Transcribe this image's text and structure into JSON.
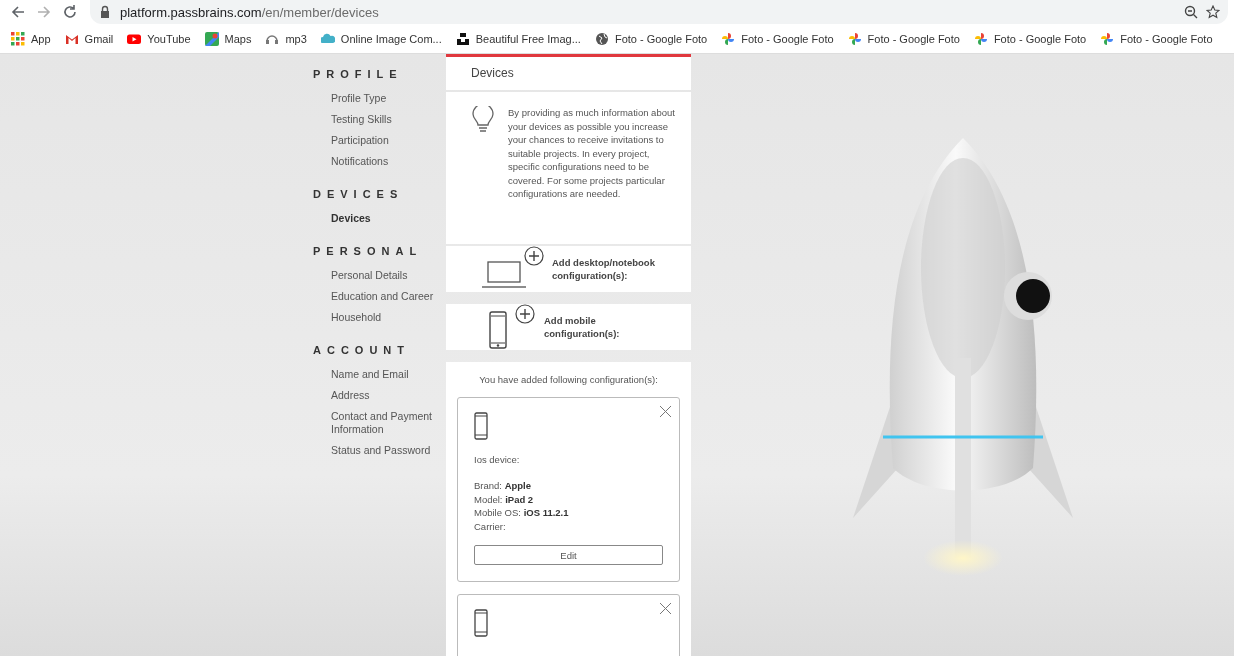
{
  "browser": {
    "url_host": "platform.passbrains.com",
    "url_path": "/en/member/devices",
    "bookmarks": [
      {
        "kind": "apps",
        "label": "App"
      },
      {
        "kind": "gmail",
        "label": "Gmail"
      },
      {
        "kind": "youtube",
        "label": "YouTube"
      },
      {
        "kind": "maps",
        "label": "Maps"
      },
      {
        "kind": "mp3",
        "label": "mp3"
      },
      {
        "kind": "cloud",
        "label": "Online Image Com..."
      },
      {
        "kind": "block",
        "label": "Beautiful Free Imag..."
      },
      {
        "kind": "globe",
        "label": "Foto - Google Foto"
      },
      {
        "kind": "pinwheel",
        "label": "Foto - Google Foto"
      },
      {
        "kind": "pinwheel",
        "label": "Foto - Google Foto"
      },
      {
        "kind": "pinwheel",
        "label": "Foto - Google Foto"
      },
      {
        "kind": "pinwheel",
        "label": "Foto - Google Foto"
      }
    ]
  },
  "sidebar": {
    "sections": [
      {
        "title": "PROFILE",
        "items": [
          {
            "label": "Profile Type",
            "selected": false
          },
          {
            "label": "Testing Skills",
            "selected": false
          },
          {
            "label": "Participation",
            "selected": false
          },
          {
            "label": "Notifications",
            "selected": false
          }
        ]
      },
      {
        "title": "DEVICES",
        "items": [
          {
            "label": "Devices",
            "selected": true
          }
        ]
      },
      {
        "title": "PERSONAL",
        "items": [
          {
            "label": "Personal Details",
            "selected": false
          },
          {
            "label": "Education and Career",
            "selected": false
          },
          {
            "label": "Household",
            "selected": false
          }
        ]
      },
      {
        "title": "ACCOUNT",
        "items": [
          {
            "label": "Name and Email",
            "selected": false
          },
          {
            "label": "Address",
            "selected": false
          },
          {
            "label": "Contact and Payment Information",
            "selected": false
          },
          {
            "label": "Status and Password",
            "selected": false
          }
        ]
      }
    ]
  },
  "panel": {
    "title": "Devices",
    "info": "By providing as much information about your devices as possible you increase your chances to receive invitations to suitable projects. In every project, specific configurations need to be covered. For some projects particular configurations are needed.",
    "add_options": [
      {
        "kind": "desktop",
        "label": "Add desktop/notebook configuration(s):"
      },
      {
        "kind": "mobile",
        "label": "Add mobile configuration(s):"
      }
    ],
    "added_heading": "You have added following configuration(s):",
    "configurations": [
      {
        "kind": "mobile",
        "type_label": "Ios device:",
        "details": [
          "Brand: **Apple**",
          "Model: **iPad 2**",
          "Mobile OS: **iOS 11.2.1**",
          "Carrier:"
        ],
        "button": "Edit"
      },
      {
        "kind": "mobile"
      }
    ]
  }
}
